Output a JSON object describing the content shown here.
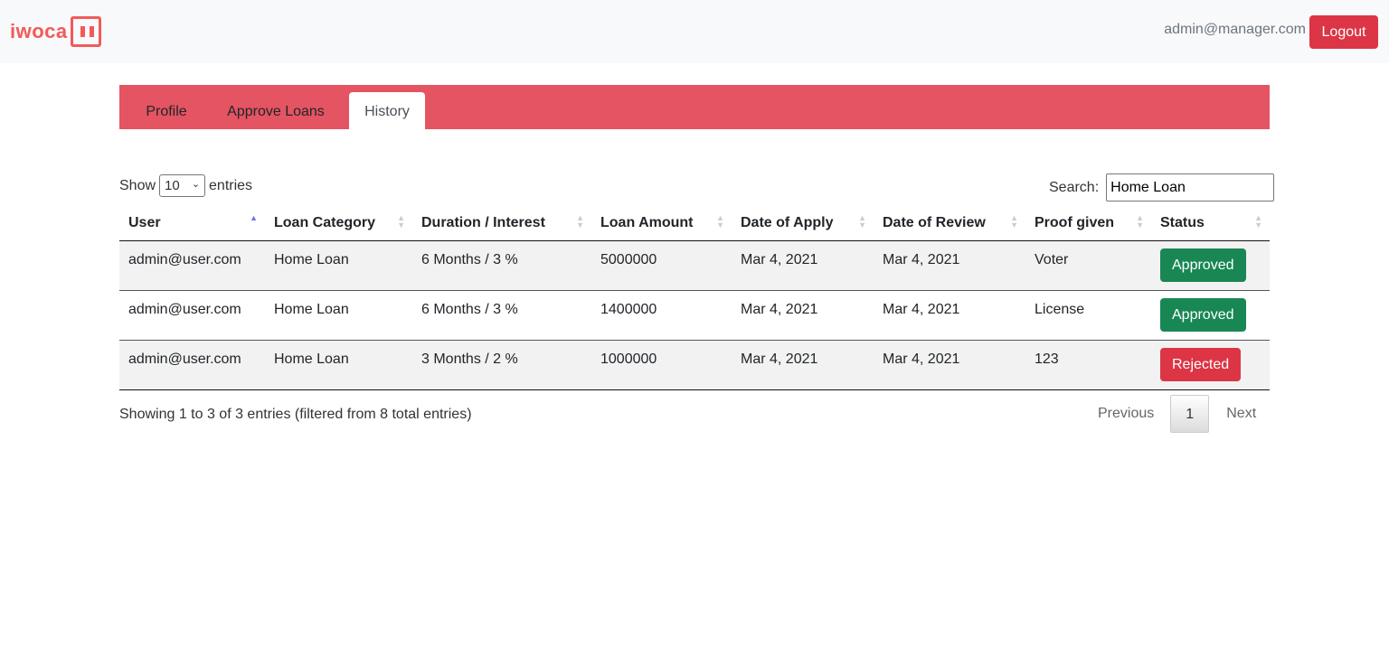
{
  "brand": {
    "logo_text": "iwoca",
    "accent_color": "#f25a5a"
  },
  "header": {
    "user_email": "admin@manager.com",
    "logout_label": "Logout"
  },
  "tabs": [
    {
      "label": "Profile",
      "active": false
    },
    {
      "label": "Approve Loans",
      "active": false
    },
    {
      "label": "History",
      "active": true
    }
  ],
  "controls": {
    "show_prefix": "Show",
    "show_value": "10",
    "show_suffix": "entries",
    "search_label": "Search:",
    "search_value": "Home Loan"
  },
  "table": {
    "columns": [
      "User",
      "Loan Category",
      "Duration / Interest",
      "Loan Amount",
      "Date of Apply",
      "Date of Review",
      "Proof given",
      "Status"
    ],
    "sorted_column": "User",
    "rows": [
      {
        "user": "admin@user.com",
        "category": "Home Loan",
        "duration": "6 Months / 3 %",
        "amount": "5000000",
        "applied": "Mar 4, 2021",
        "reviewed": "Mar 4, 2021",
        "proof": "Voter",
        "status": "Approved"
      },
      {
        "user": "admin@user.com",
        "category": "Home Loan",
        "duration": "6 Months / 3 %",
        "amount": "1400000",
        "applied": "Mar 4, 2021",
        "reviewed": "Mar 4, 2021",
        "proof": "License",
        "status": "Approved"
      },
      {
        "user": "admin@user.com",
        "category": "Home Loan",
        "duration": "3 Months / 2 %",
        "amount": "1000000",
        "applied": "Mar 4, 2021",
        "reviewed": "Mar 4, 2021",
        "proof": "123",
        "status": "Rejected"
      }
    ]
  },
  "footer": {
    "info": "Showing 1 to 3 of 3 entries (filtered from 8 total entries)",
    "previous_label": "Previous",
    "page": "1",
    "next_label": "Next"
  },
  "colors": {
    "tabbar": "#e45462",
    "approved": "#198754",
    "rejected": "#dc3545"
  }
}
